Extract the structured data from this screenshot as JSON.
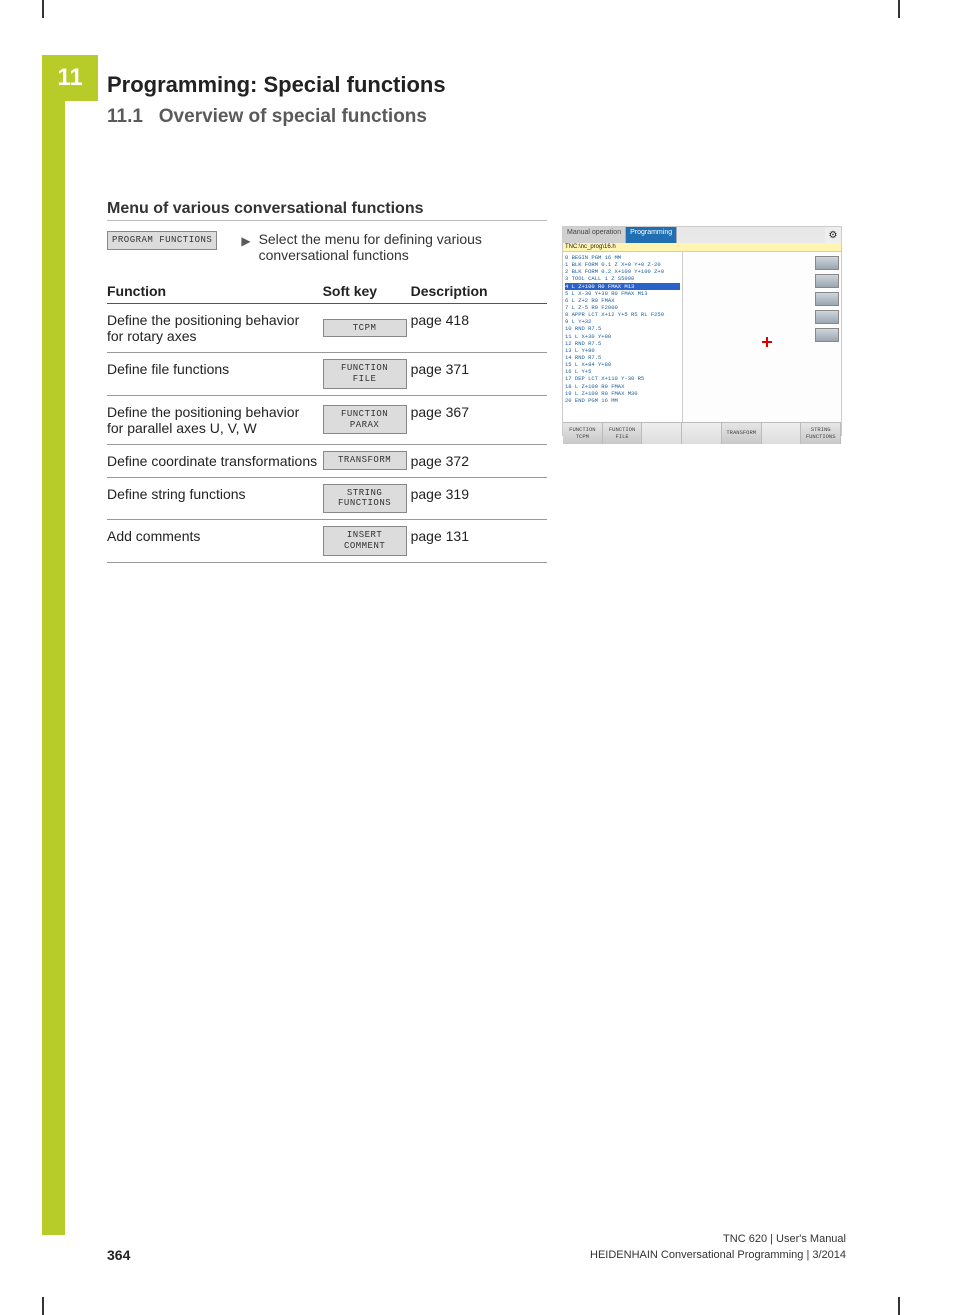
{
  "chapter_number": "11",
  "title": "Programming: Special functions",
  "subtitle_num": "11.1",
  "subtitle_text": "Overview of special functions",
  "section_heading": "Menu of various conversational functions",
  "intro": {
    "softkey": "PROGRAM FUNCTIONS",
    "text": "Select the menu for defining various conversational functions"
  },
  "table": {
    "headers": {
      "func": "Function",
      "sk": "Soft key",
      "desc": "Description"
    },
    "rows": [
      {
        "func": "Define the positioning behavior for rotary axes",
        "sk": "TCPM",
        "desc": "page 418"
      },
      {
        "func": "Define file functions",
        "sk": "FUNCTION FILE",
        "desc": "page 371"
      },
      {
        "func": "Define the positioning behavior for parallel axes U, V, W",
        "sk": "FUNCTION PARAX",
        "desc": "page 367"
      },
      {
        "func": "Define coordinate transformations",
        "sk": "TRANSFORM",
        "desc": "page 372"
      },
      {
        "func": "Define string functions",
        "sk": "STRING FUNCTIONS",
        "desc": "page 319"
      },
      {
        "func": "Add comments",
        "sk": "INSERT COMMENT",
        "desc": "page 131"
      }
    ]
  },
  "screenshot": {
    "tab1": "Manual operation",
    "tab2": "Programming",
    "tab2sub": "Programming",
    "path": "TNC:\\nc_prog\\16.h",
    "lines": [
      "0 BEGIN PGM 16 MM",
      "1 BLK FORM 0.1 Z X+0 Y+0 Z-20",
      "2 BLK FORM 0.2  X+100  Y+100  Z+0",
      "3 TOOL CALL 1 Z S5000",
      "4 L  Z+100 R0 FMAX M13",
      "5 L  X-30  Y+30 R0 FMAX M13",
      "6 L  Z+2 R0 FMAX",
      "7 L  Z-5 R0 F2000",
      "8 APPR LCT  X+12  Y+5 R5 RL F250",
      "9 L  Y+32",
      "10 RND R7.5",
      "11 L  X+30  Y+80",
      "12 RND R7.5",
      "13 L  Y+80",
      "14 RND R7.5",
      "15 L  X+84  Y+80",
      "16 L  Y+5",
      "17 DEP LCT  X+110  Y-30 R5",
      "18 L  Z+100 R0 FMAX",
      "19 L  Z+100 R0 FMAX M30",
      "20 END PGM 16 MM"
    ],
    "highlight_index": 4,
    "bottom_keys": [
      "FUNCTION TCPM",
      "FUNCTION FILE",
      "",
      "",
      "TRANSFORM",
      "",
      "STRING FUNCTIONS"
    ]
  },
  "footer": {
    "page": "364",
    "line1": "TNC 620 | User's Manual",
    "line2": "HEIDENHAIN Conversational Programming | 3/2014"
  }
}
